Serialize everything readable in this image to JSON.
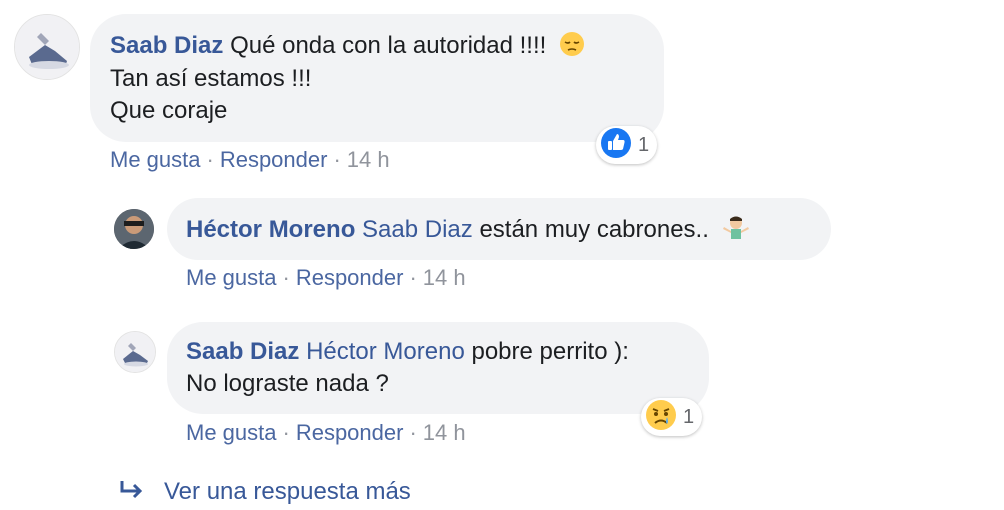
{
  "comments": [
    {
      "author": "Saab Diaz",
      "lines": [
        "Qué onda con la autoridad !!!!",
        "Tan así estamos !!!",
        "Que coraje"
      ],
      "emoji": "pensive-face",
      "actions": {
        "like": "Me gusta",
        "reply": "Responder",
        "time": "14 h"
      },
      "reaction": {
        "type": "like-icon",
        "count": "1"
      }
    },
    {
      "author": "Héctor Moreno",
      "mention": "Saab Diaz",
      "text": "están muy cabrones..",
      "emoji": "man-shrugging",
      "actions": {
        "like": "Me gusta",
        "reply": "Responder",
        "time": "14 h"
      }
    },
    {
      "author": "Saab Diaz",
      "mention": "Héctor Moreno",
      "text": "pobre perrito ):",
      "line2": "No lograste nada ?",
      "actions": {
        "like": "Me gusta",
        "reply": "Responder",
        "time": "14 h"
      },
      "reaction": {
        "type": "sad-face-icon",
        "count": "1"
      }
    }
  ],
  "more_replies": {
    "icon": "reply-arrow-icon",
    "label": "Ver una respuesta más"
  },
  "colors": {
    "name": "#385898",
    "bubble": "#f2f3f5",
    "meta": "#90949c",
    "like": "#1877f2"
  }
}
